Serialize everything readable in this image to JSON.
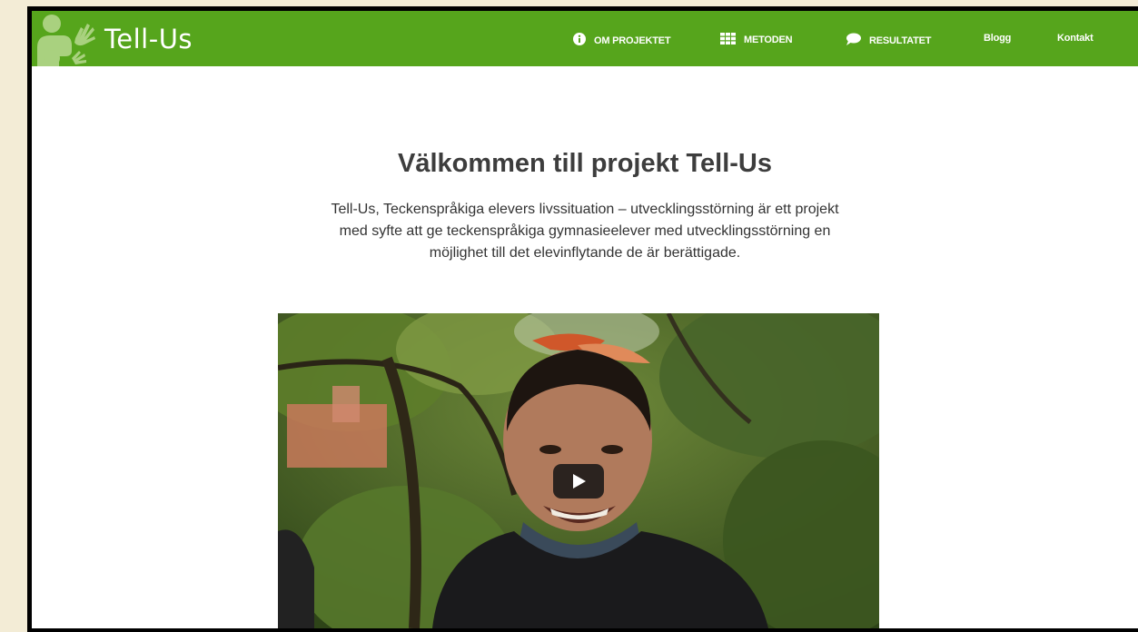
{
  "site": {
    "logo_text": "Tell-Us"
  },
  "nav": {
    "items": [
      {
        "label": "OM PROJEKTET",
        "icon": "info-circle-icon"
      },
      {
        "label": "METODEN",
        "icon": "grid-icon"
      },
      {
        "label": "RESULTATET",
        "icon": "speech-bubble-icon"
      },
      {
        "label": "Blogg",
        "icon": ""
      },
      {
        "label": "Kontakt",
        "icon": ""
      }
    ]
  },
  "main": {
    "title": "Välkommen till projekt Tell-Us",
    "intro_lines": [
      "Tell-Us, Teckenspråkiga elevers livssituation – utvecklingsstörning är ett projekt",
      "med syfte att ge teckenspråkiga gymnasieelever med utvecklingsstörning en",
      "möjlighet till det elevinflytande de är berättigade."
    ]
  },
  "video": {
    "play_icon": "play-icon"
  },
  "colors": {
    "brand_green": "#56a51c",
    "logo_figure": "#a9d17f",
    "outer_background": "#f3ecd6"
  }
}
